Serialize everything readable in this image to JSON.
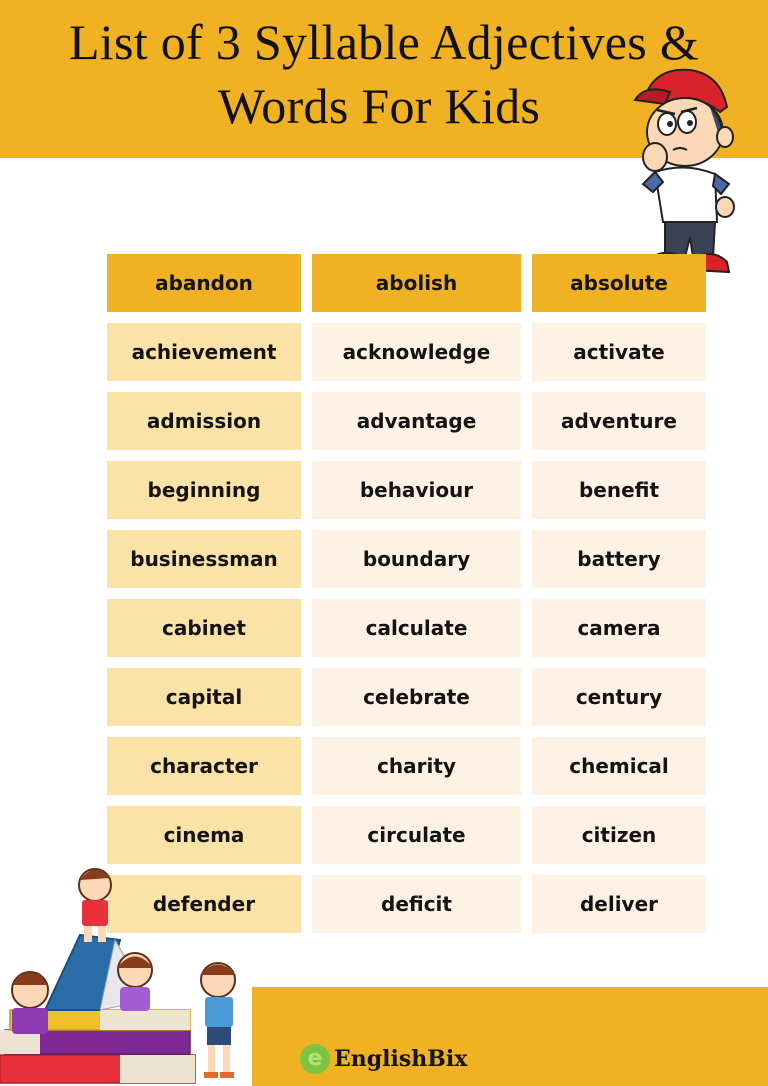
{
  "header": {
    "title_line1": "List of 3 Syllable Adjectives &",
    "title_line2": "Words For Kids"
  },
  "colors": {
    "accent": "#F0B122",
    "column1_bg": "#FBE3A8",
    "column23_bg": "#FDF2E3",
    "text": "#141414"
  },
  "table": {
    "header_row": [
      "abandon",
      "abolish",
      "absolute"
    ],
    "rows": [
      [
        "achievement",
        "acknowledge",
        "activate"
      ],
      [
        "admission",
        "advantage",
        "adventure"
      ],
      [
        "beginning",
        "behaviour",
        "benefit"
      ],
      [
        "businessman",
        "boundary",
        "battery"
      ],
      [
        "cabinet",
        "calculate",
        "camera"
      ],
      [
        "capital",
        "celebrate",
        "century"
      ],
      [
        "character",
        "charity",
        "chemical"
      ],
      [
        "cinema",
        "circulate",
        "citizen"
      ],
      [
        "defender",
        "deficit",
        "deliver"
      ]
    ]
  },
  "footer": {
    "brand_logo_letter": "e",
    "brand_name": "EnglishBix"
  },
  "illustrations": {
    "top_right": "thinking-boy-with-red-cap",
    "bottom_left": "kids-reading-on-book-stack"
  }
}
